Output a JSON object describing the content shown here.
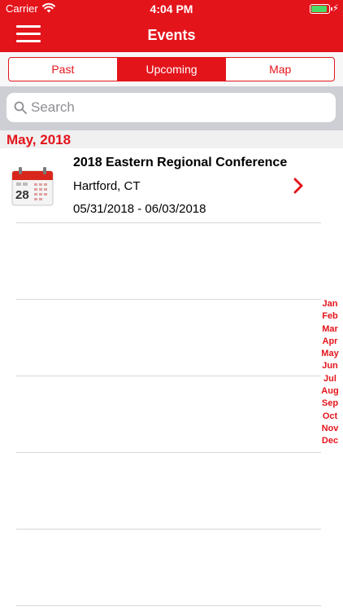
{
  "status_bar": {
    "carrier": "Carrier",
    "time": "4:04 PM",
    "battery_color": "#4cd964"
  },
  "nav": {
    "title": "Events",
    "menu_icon": "hamburger-menu-icon",
    "accent_color": "#e4141b"
  },
  "segments": {
    "items": [
      "Past",
      "Upcoming",
      "Map"
    ],
    "selected": "Upcoming"
  },
  "search": {
    "placeholder": "Search",
    "value": ""
  },
  "sections": [
    {
      "title": "May, 2018",
      "events": [
        {
          "name": "2018 Eastern Regional Conference",
          "location": "Hartford, CT",
          "dates": "05/31/2018 - 06/03/2018",
          "icon": "calendar-icon",
          "icon_day": "28"
        }
      ]
    }
  ],
  "month_index": [
    "Jan",
    "Feb",
    "Mar",
    "Apr",
    "May",
    "Jun",
    "Jul",
    "Aug",
    "Sep",
    "Oct",
    "Nov",
    "Dec"
  ]
}
